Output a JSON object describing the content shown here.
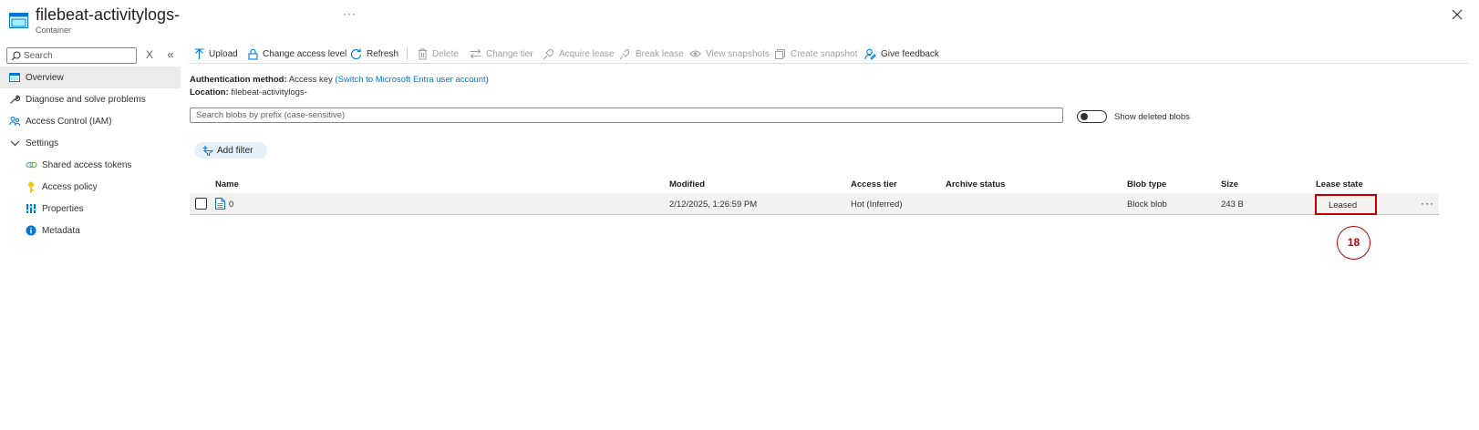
{
  "header": {
    "title": "filebeat-activitylogs-",
    "subtitle": "Container",
    "more_label": "···"
  },
  "sidebar": {
    "search_placeholder": "Search",
    "clear_label": "X",
    "collapse_label": "«",
    "items": [
      {
        "label": "Overview",
        "icon": "container-icon",
        "active": true
      },
      {
        "label": "Diagnose and solve problems",
        "icon": "wrench-icon"
      },
      {
        "label": "Access Control (IAM)",
        "icon": "people-icon"
      },
      {
        "label": "Settings",
        "icon": "chevron-down-icon"
      },
      {
        "label": "Shared access tokens",
        "icon": "link-icon"
      },
      {
        "label": "Access policy",
        "icon": "key-icon"
      },
      {
        "label": "Properties",
        "icon": "properties-icon"
      },
      {
        "label": "Metadata",
        "icon": "info-icon"
      }
    ]
  },
  "toolbar": {
    "upload": "Upload",
    "change_access_level": "Change access level",
    "refresh": "Refresh",
    "delete": "Delete",
    "change_tier": "Change tier",
    "acquire_lease": "Acquire lease",
    "break_lease": "Break lease",
    "view_snapshots": "View snapshots",
    "create_snapshot": "Create snapshot",
    "give_feedback": "Give feedback"
  },
  "info": {
    "auth_label": "Authentication method:",
    "auth_value": "Access key",
    "auth_link": "(Switch to Microsoft Entra user account)",
    "location_label": "Location:",
    "location_value": "filebeat-activitylogs-"
  },
  "blob_search": {
    "placeholder": "Search blobs by prefix (case-sensitive)"
  },
  "show_deleted": {
    "label": "Show deleted blobs",
    "on": false
  },
  "filter": {
    "add_label": "Add filter"
  },
  "table": {
    "columns": [
      "Name",
      "Modified",
      "Access tier",
      "Archive status",
      "Blob type",
      "Size",
      "Lease state"
    ],
    "rows": [
      {
        "name": "0",
        "modified": "2/12/2025, 1:26:59 PM",
        "access_tier": "Hot (Inferred)",
        "archive_status": "",
        "blob_type": "Block blob",
        "size": "243 B",
        "lease_state": "Leased",
        "more": "···"
      }
    ]
  },
  "annotation": {
    "number": "18",
    "color": "#c00000"
  },
  "colors": {
    "accent": "#0078d4",
    "active_nav": "#edebe9",
    "row_bg": "#f3f2f1",
    "filter_pill": "#e6f0fa"
  }
}
